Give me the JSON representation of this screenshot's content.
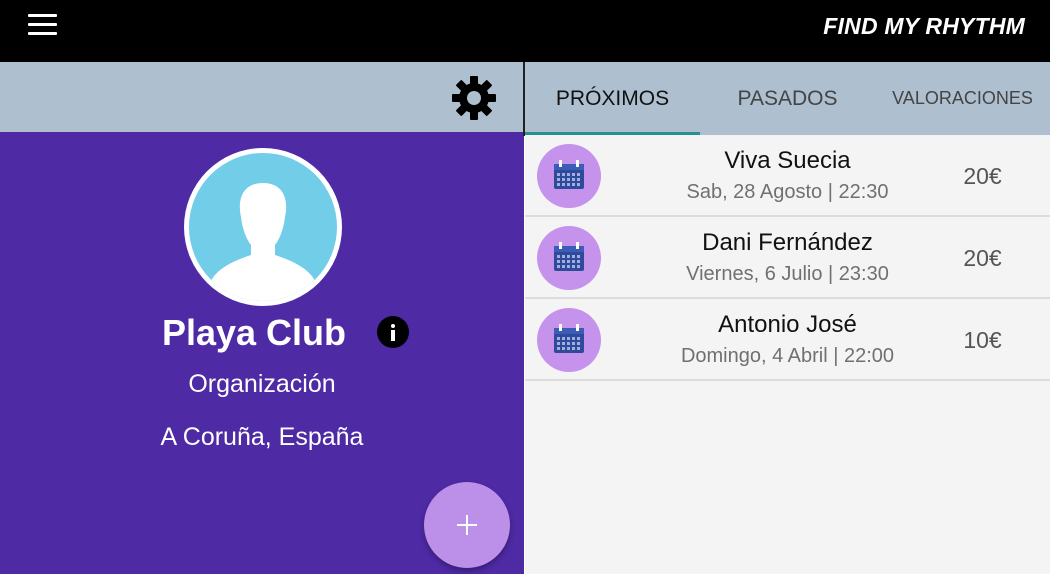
{
  "app": {
    "title": "FIND MY RHYTHM"
  },
  "icons": {
    "menu": "hamburger-menu-icon",
    "settings": "gear-icon",
    "info": "info-icon",
    "add": "plus-icon",
    "event": "calendar-icon",
    "avatar": "person-silhouette-icon"
  },
  "profile": {
    "name": "Playa Club",
    "role": "Organización",
    "location": "A Coruña, España"
  },
  "tabs": [
    {
      "label": "PRÓXIMOS",
      "active": true
    },
    {
      "label": "PASADOS",
      "active": false
    },
    {
      "label": "VALORACIONES",
      "active": false
    }
  ],
  "events": [
    {
      "title": "Viva Suecia",
      "date": "Sab, 28 Agosto | 22:30",
      "price": "20€"
    },
    {
      "title": "Dani Fernández",
      "date": "Viernes, 6 Julio | 23:30",
      "price": "20€"
    },
    {
      "title": "Antonio José",
      "date": "Domingo, 4 Abril | 22:00",
      "price": "10€"
    }
  ],
  "colors": {
    "topbar": "#000000",
    "header": "#aebfcf",
    "profile_bg": "#4e2aa5",
    "fab": "#bc8fe8",
    "event_icon_bg": "#c592ec",
    "tab_indicator": "#2a8f8f",
    "avatar_bg": "#71cde8"
  }
}
